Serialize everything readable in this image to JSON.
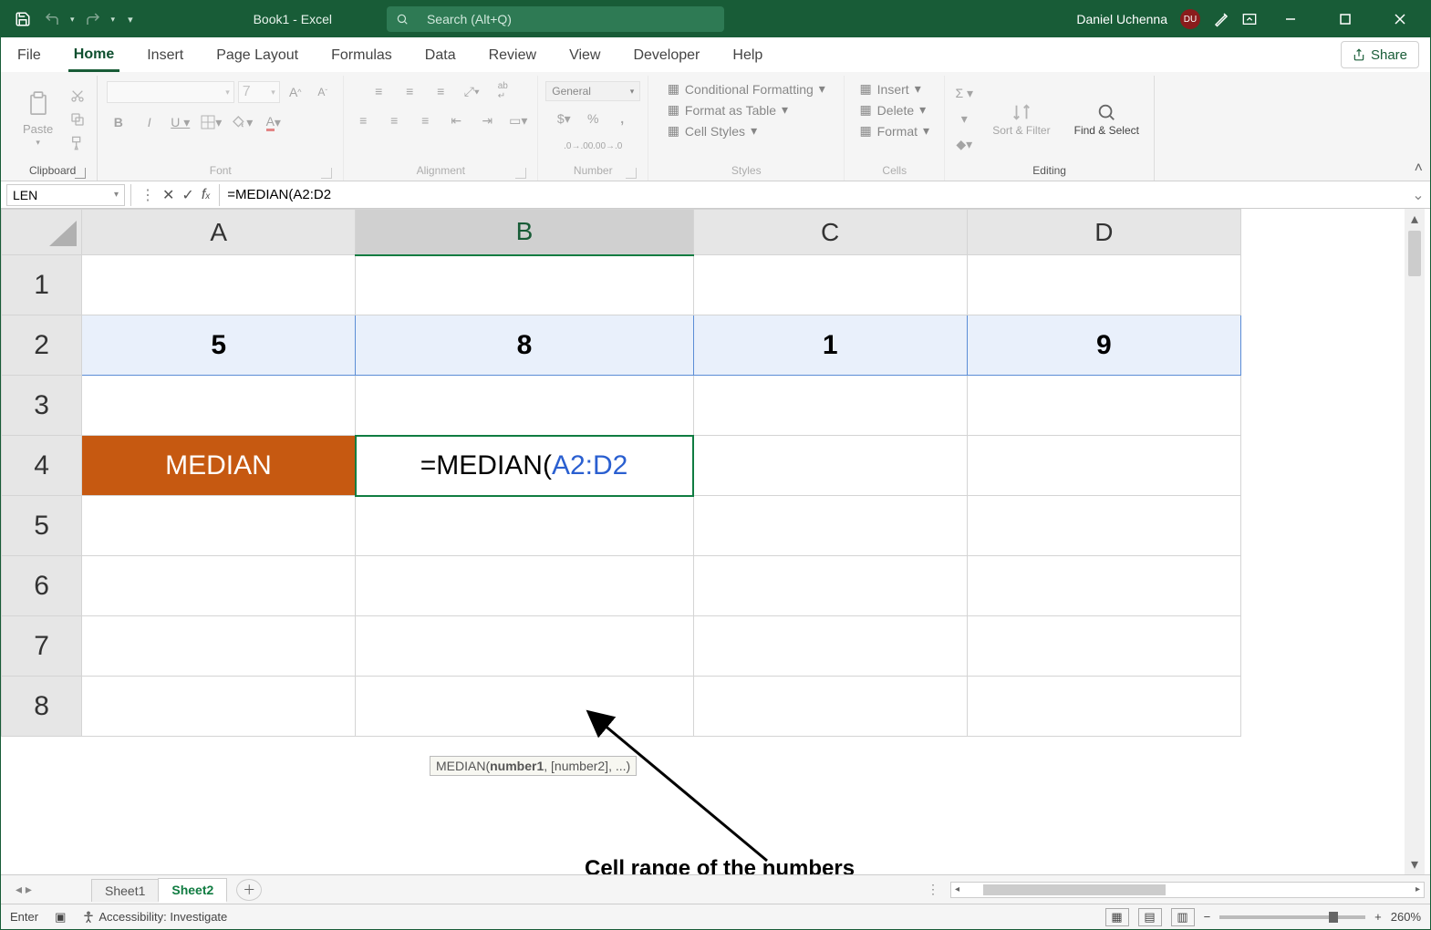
{
  "titlebar": {
    "doc_title": "Book1  -  Excel",
    "search_placeholder": "Search (Alt+Q)",
    "user_name": "Daniel Uchenna",
    "user_initials": "DU"
  },
  "ribbon_tabs": {
    "file": "File",
    "home": "Home",
    "insert": "Insert",
    "page_layout": "Page Layout",
    "formulas": "Formulas",
    "data": "Data",
    "review": "Review",
    "view": "View",
    "developer": "Developer",
    "help": "Help",
    "share": "Share"
  },
  "ribbon": {
    "clipboard": {
      "label": "Clipboard",
      "paste": "Paste"
    },
    "font": {
      "label": "Font",
      "size": "7"
    },
    "alignment": {
      "label": "Alignment"
    },
    "number": {
      "label": "Number",
      "format": "General"
    },
    "styles": {
      "label": "Styles",
      "cond": "Conditional Formatting",
      "table": "Format as Table",
      "cell": "Cell Styles"
    },
    "cells": {
      "label": "Cells",
      "insert": "Insert",
      "delete": "Delete",
      "format": "Format"
    },
    "editing": {
      "label": "Editing",
      "sort": "Sort & Filter",
      "find": "Find & Select"
    }
  },
  "formula_bar": {
    "name_box": "LEN",
    "formula": "=MEDIAN(A2:D2"
  },
  "grid": {
    "col_headers": [
      "A",
      "B",
      "C",
      "D"
    ],
    "row_headers": [
      "1",
      "2",
      "3",
      "4",
      "5",
      "6",
      "7",
      "8"
    ],
    "row2": {
      "A": "5",
      "B": "8",
      "C": "1",
      "D": "9"
    },
    "row4": {
      "A": "MEDIAN",
      "B_prefix": "=MEDIAN(",
      "B_range": "A2:D2"
    },
    "tooltip_fn": "MEDIAN(",
    "tooltip_arg1": "number1",
    "tooltip_rest": ", [number2], ...)",
    "annotation": "Cell range of the numbers"
  },
  "sheet_tabs": {
    "sheet1": "Sheet1",
    "sheet2": "Sheet2"
  },
  "statusbar": {
    "mode": "Enter",
    "accessibility": "Accessibility: Investigate",
    "zoom": "260%"
  }
}
